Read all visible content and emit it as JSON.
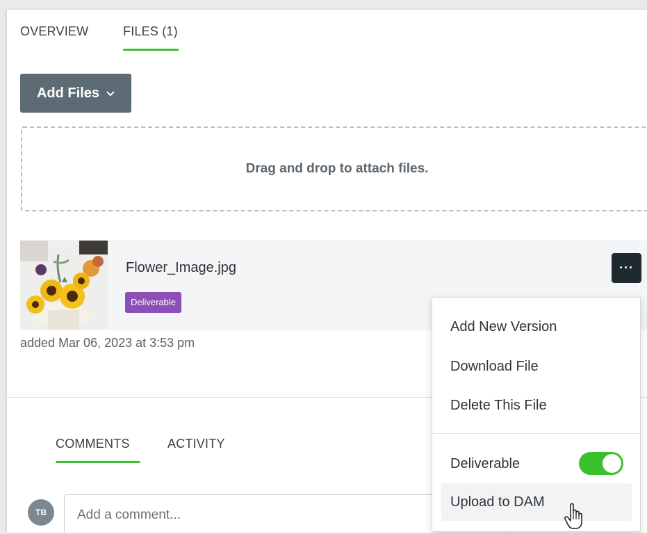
{
  "tabs": [
    {
      "label": "OVERVIEW",
      "active": false
    },
    {
      "label": "FILES (1)",
      "active": true
    }
  ],
  "add_files_button": {
    "label": "Add Files",
    "icon": "chevron-down-icon"
  },
  "dropzone": {
    "text": "Drag and drop to attach files."
  },
  "file": {
    "name": "Flower_Image.jpg",
    "badge": "Deliverable",
    "added": "added Mar 06, 2023 at 3:53 pm",
    "more_label": "···"
  },
  "comment_tabs": [
    {
      "label": "COMMENTS",
      "active": true
    },
    {
      "label": "ACTIVITY",
      "active": false
    }
  ],
  "comment": {
    "avatar_initials": "TB",
    "placeholder": "Add a comment..."
  },
  "context_menu": {
    "items": [
      "Add New Version",
      "Download File",
      "Delete This File"
    ],
    "deliverable_label": "Deliverable",
    "deliverable_on": true,
    "upload_label": "Upload to DAM"
  },
  "colors": {
    "accent": "#3cbf2c",
    "badge": "#8c4fb5",
    "button": "#5c6b74",
    "more_button": "#1f2a30"
  }
}
